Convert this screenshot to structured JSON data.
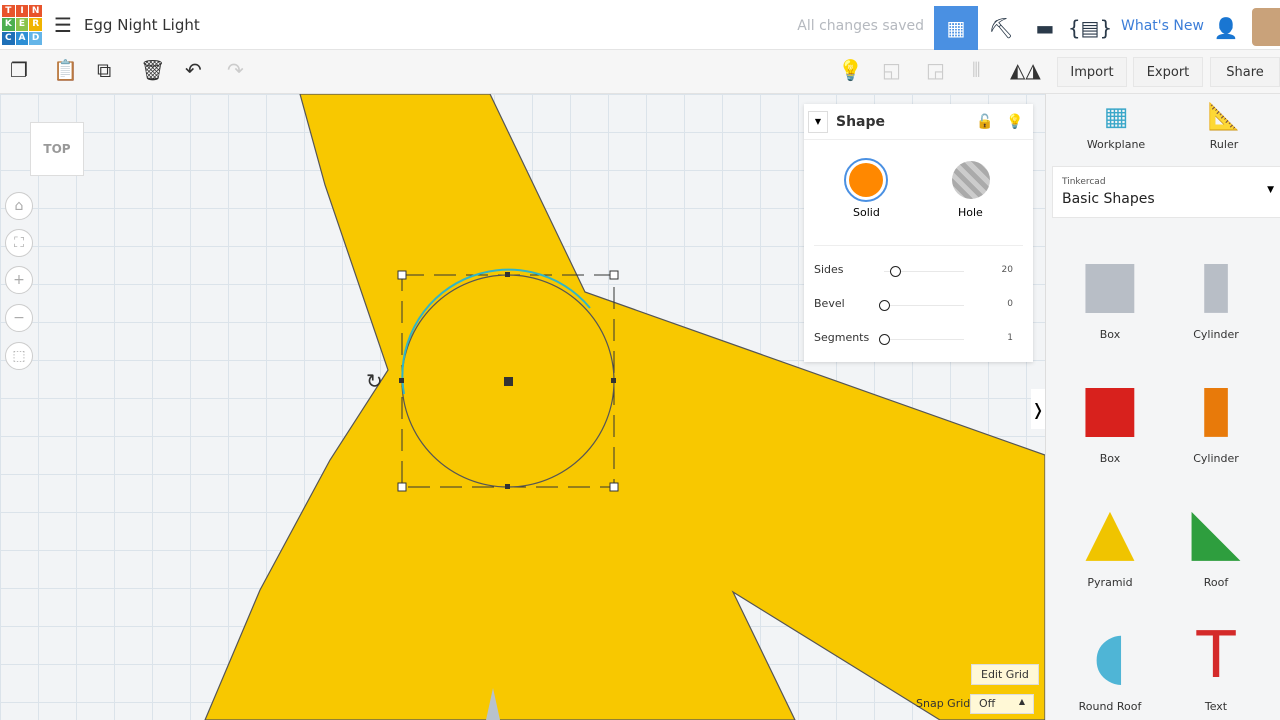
{
  "app": {
    "logo_letters": [
      "T",
      "I",
      "N",
      "K",
      "E",
      "R",
      "C",
      "A",
      "D"
    ],
    "title": "Egg Night Light",
    "status": "All changes saved",
    "whats_new": "What's New"
  },
  "toolbar": {
    "import": "Import",
    "export": "Export",
    "share": "Share"
  },
  "viewcube": {
    "label": "TOP"
  },
  "inspector": {
    "title": "Shape",
    "solid": "Solid",
    "hole": "Hole",
    "props": [
      {
        "label": "Sides",
        "value": "20",
        "fraction": 0.1
      },
      {
        "label": "Bevel",
        "value": "0",
        "fraction": 0
      },
      {
        "label": "Segments",
        "value": "1",
        "fraction": 0
      }
    ]
  },
  "panel": {
    "workplane": "Workplane",
    "ruler": "Ruler",
    "library_vendor": "Tinkercad",
    "library_name": "Basic Shapes",
    "shapes": [
      {
        "name": "Box",
        "color": "#b8bec6"
      },
      {
        "name": "Cylinder",
        "color": "#b8bec6"
      },
      {
        "name": "Box",
        "color": "#d8211d"
      },
      {
        "name": "Cylinder",
        "color": "#e87a0a"
      },
      {
        "name": "Pyramid",
        "color": "#f0c400"
      },
      {
        "name": "Roof",
        "color": "#2e9e3e"
      },
      {
        "name": "Round Roof",
        "color": "#4fb5d6"
      },
      {
        "name": "Text",
        "color": "#d42a2a"
      }
    ]
  },
  "grid": {
    "edit_grid": "Edit Grid",
    "snap_grid_label": "Snap Grid",
    "snap_grid_value": "Off"
  },
  "colors": {
    "accent": "#4a90e2",
    "shape_fill": "#f8c800",
    "solid": "#ff8800"
  }
}
